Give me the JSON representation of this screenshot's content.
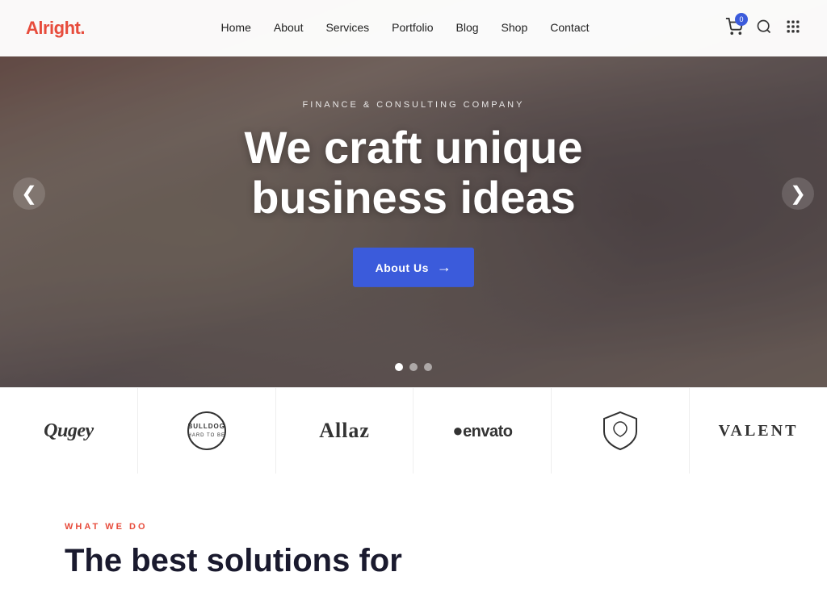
{
  "brand": {
    "name": "Alright",
    "dot": "."
  },
  "nav": {
    "items": [
      {
        "label": "Home",
        "href": "#"
      },
      {
        "label": "About",
        "href": "#"
      },
      {
        "label": "Services",
        "href": "#"
      },
      {
        "label": "Portfolio",
        "href": "#"
      },
      {
        "label": "Blog",
        "href": "#"
      },
      {
        "label": "Shop",
        "href": "#"
      },
      {
        "label": "Contact",
        "href": "#"
      }
    ]
  },
  "cart": {
    "count": "0"
  },
  "hero": {
    "subtitle": "Finance & Consulting Company",
    "title_line1": "We craft unique",
    "title_line2": "business ideas",
    "cta_label": "About Us",
    "slider_arrow_left": "❮",
    "slider_arrow_right": "❯"
  },
  "logos": [
    {
      "id": "qugey",
      "type": "text",
      "text": "Qugey",
      "style": "sans"
    },
    {
      "id": "bulldog",
      "type": "circle",
      "text": "BULLDOG\nHARD TO BE"
    },
    {
      "id": "allaz",
      "type": "text",
      "text": "Allaz",
      "style": "serif"
    },
    {
      "id": "envato",
      "type": "text",
      "text": "●envato",
      "style": "sans"
    },
    {
      "id": "shield",
      "type": "shield",
      "text": "⛨"
    },
    {
      "id": "valent",
      "type": "text",
      "text": "VALENT",
      "style": "caps"
    }
  ],
  "section": {
    "tag": "What We Do",
    "title_line1": "The best solutions for"
  }
}
